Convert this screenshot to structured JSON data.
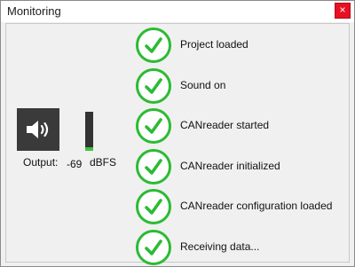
{
  "window": {
    "title": "Monitoring",
    "close_label": "×"
  },
  "output": {
    "icon": "speaker-icon",
    "label": "Output:",
    "level_value": "-69",
    "level_unit": "dBFS",
    "meter_fill_fraction": 0.08,
    "meter_color": "#3cc23c"
  },
  "status": {
    "check_color": "#2bbb33",
    "items": [
      {
        "label": "Project loaded"
      },
      {
        "label": "Sound on"
      },
      {
        "label": "CANreader started"
      },
      {
        "label": "CANreader initialized"
      },
      {
        "label": "CANreader configuration loaded"
      },
      {
        "label": "Receiving data..."
      }
    ]
  }
}
